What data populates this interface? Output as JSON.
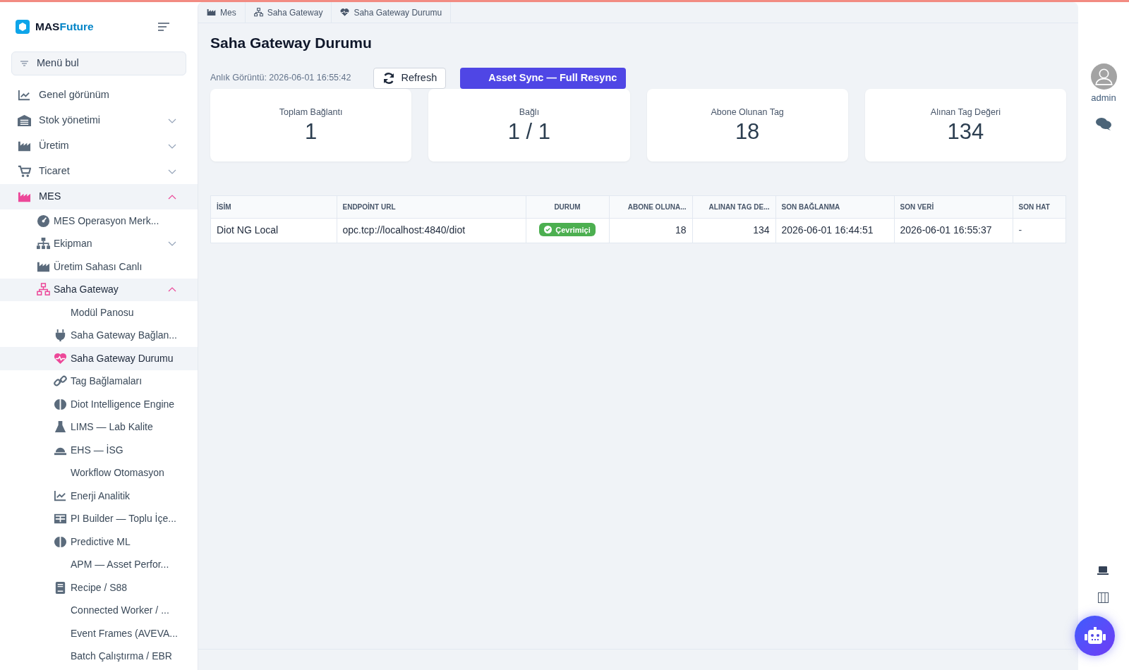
{
  "brand": {
    "part_1": "MAS",
    "part_2": "Future"
  },
  "menu_search": {
    "placeholder": "Menü bul"
  },
  "sidebar": {
    "items": [
      {
        "label": "Genel görünüm"
      },
      {
        "label": "Stok yönetimi",
        "expanded": false
      },
      {
        "label": "Üretim",
        "expanded": false
      },
      {
        "label": "Ticaret",
        "expanded": false
      },
      {
        "label": "MES",
        "expanded": true,
        "children": [
          {
            "label": "MES Operasyon Merk..."
          },
          {
            "label": "Ekipman",
            "expanded": false
          },
          {
            "label": "Üretim Sahası Canlı"
          },
          {
            "label": "Saha Gateway",
            "expanded": true,
            "children": [
              {
                "label": "Modül Panosu",
                "selected": false
              },
              {
                "label": "Saha Gateway Bağlan...",
                "selected": false
              },
              {
                "label": "Saha Gateway Durumu",
                "selected": true
              },
              {
                "label": "Tag Bağlamaları",
                "selected": false
              },
              {
                "label": "Diot Intelligence Engine",
                "selected": false
              },
              {
                "label": "LIMS — Lab Kalite",
                "selected": false
              },
              {
                "label": "EHS — İSG",
                "selected": false
              },
              {
                "label": "Workflow Otomasyon",
                "selected": false
              },
              {
                "label": "Enerji Analitik",
                "selected": false
              },
              {
                "label": "PI Builder — Toplu İçe...",
                "selected": false
              },
              {
                "label": "Predictive ML",
                "selected": false
              },
              {
                "label": "APM — Asset Perfor...",
                "selected": false
              },
              {
                "label": "Recipe / S88",
                "selected": false
              },
              {
                "label": "Connected Worker / ...",
                "selected": false
              },
              {
                "label": "Event Frames (AVEVA...",
                "selected": false
              },
              {
                "label": "Batch Çalıştırma / EBR",
                "selected": false
              }
            ]
          }
        ]
      }
    ]
  },
  "breadcrumbs": [
    "Mes",
    "Saha Gateway",
    "Saha Gateway Durumu"
  ],
  "page_title": "Saha Gateway Durumu",
  "snapshot": "Anlık Görüntü: 2026-06-01 16:55:42",
  "buttons": {
    "refresh": "Refresh",
    "resync": "Asset Sync — Full Resync"
  },
  "stats": [
    {
      "label": "Toplam Bağlantı",
      "value": "1"
    },
    {
      "label": "Bağlı",
      "value": "1 / 1"
    },
    {
      "label": "Abone Olunan Tag",
      "value": "18"
    },
    {
      "label": "Alınan Tag Değeri",
      "value": "134"
    }
  ],
  "table": {
    "columns": [
      "İSİM",
      "ENDPOİNT URL",
      "DURUM",
      "ABONE OLUNA...",
      "ALINAN TAG DE...",
      "SON BAĞLANMA",
      "SON VERİ",
      "SON HAT"
    ],
    "rows": [
      {
        "name": "Diot NG Local",
        "endpoint": "opc.tcp://localhost:4840/diot",
        "status": "Çevrimiçi",
        "online": true,
        "subscribed": "18",
        "received": "134",
        "last_connect": "2026-06-01 16:44:51",
        "last_data": "2026-06-01 16:55:37",
        "last_error": "-"
      }
    ]
  },
  "user": {
    "name": "admin"
  }
}
